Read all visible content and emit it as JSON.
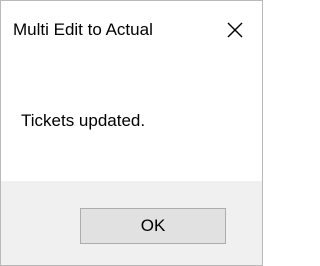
{
  "dialog": {
    "title": "Multi Edit to Actual",
    "message": "Tickets updated.",
    "ok_label": "OK",
    "close_icon": "close-icon"
  },
  "colors": {
    "background": "#ffffff",
    "footer_background": "#f0f0f0",
    "button_background": "#e1e1e1",
    "button_border": "#adadad",
    "text": "#000000"
  }
}
